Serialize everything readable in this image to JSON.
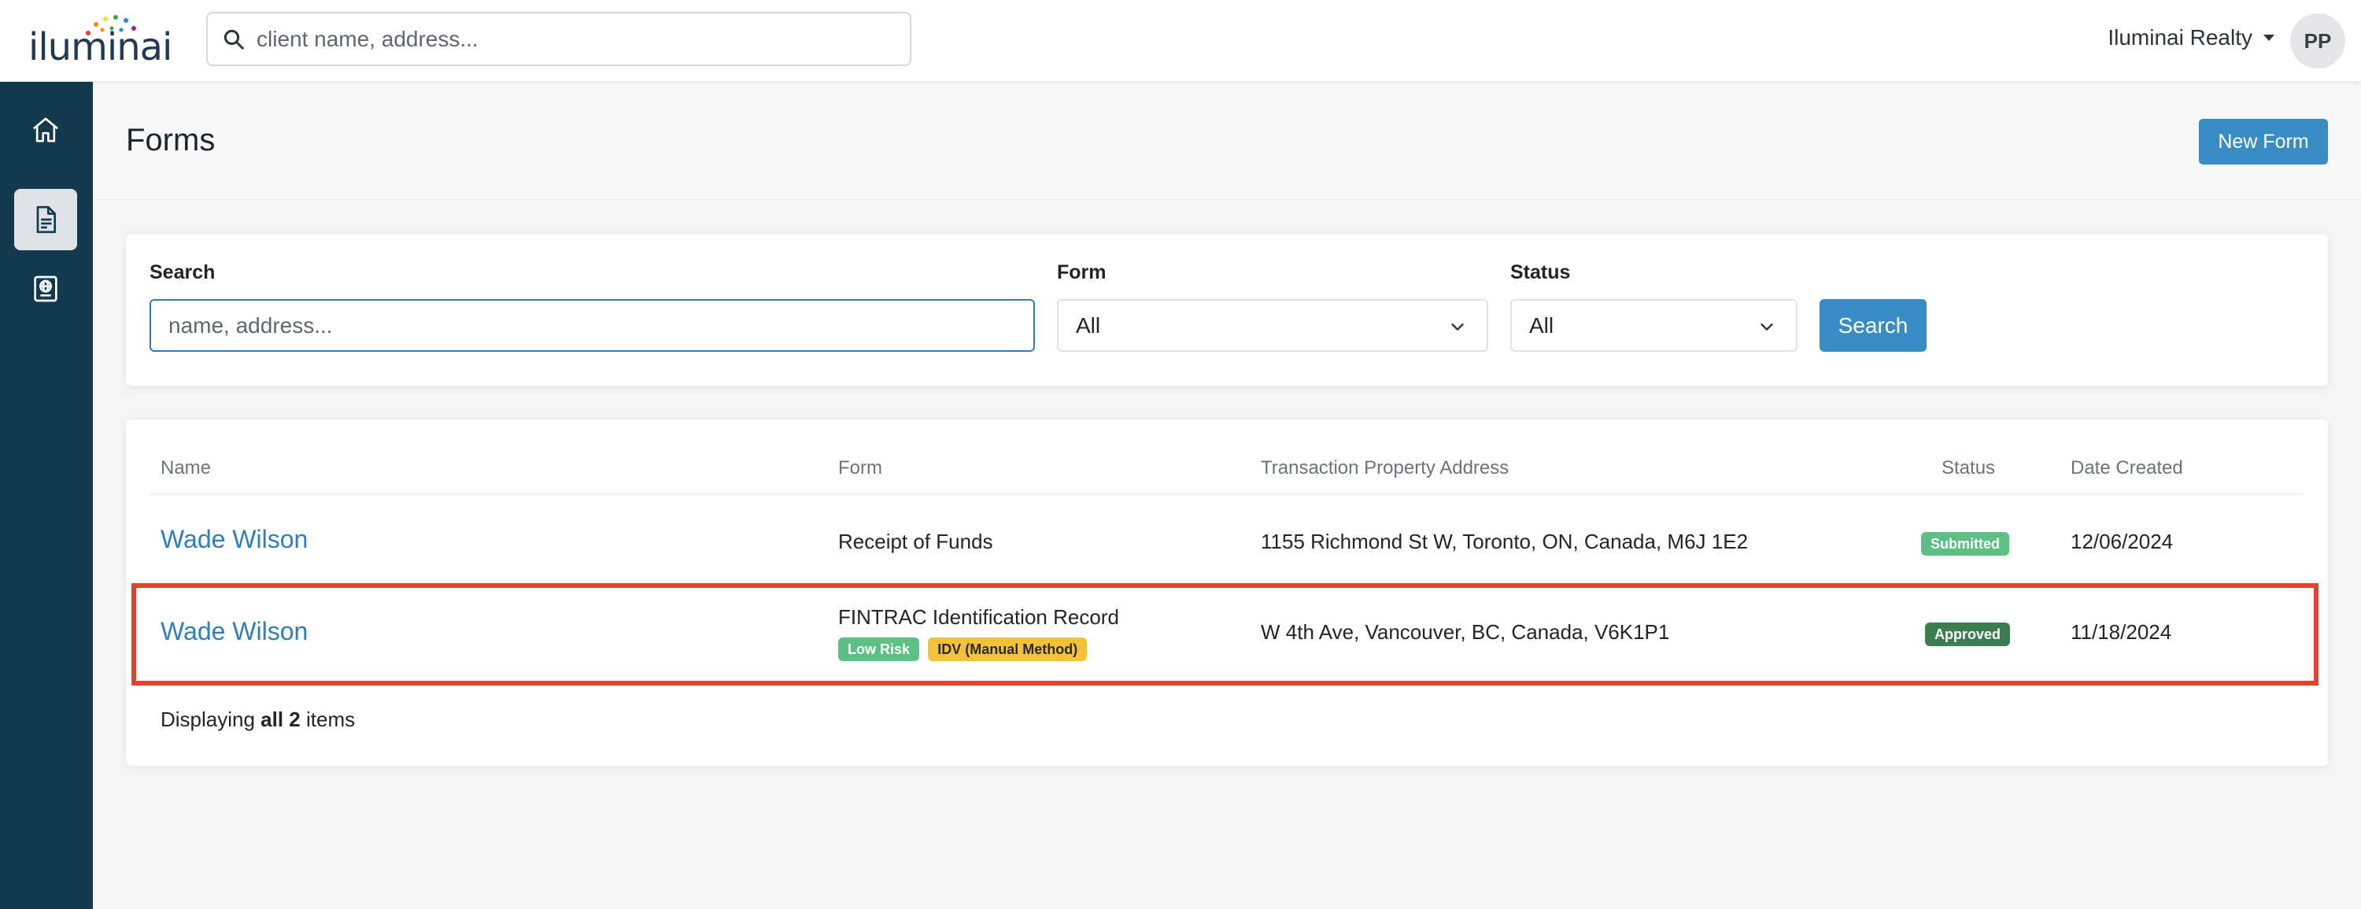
{
  "brand": {
    "logo_text": "iluminai",
    "logo_dot_colors": [
      "#e53935",
      "#fb8c00",
      "#fdd835",
      "#43a047",
      "#1e88e5",
      "#8e24aa"
    ]
  },
  "topbar": {
    "search_placeholder": "client name, address...",
    "account_name": "Iluminai Realty",
    "avatar_initials": "PP"
  },
  "sidebar": {
    "items": [
      {
        "icon": "home-icon",
        "active": false
      },
      {
        "icon": "document-icon",
        "active": true
      },
      {
        "icon": "globe-id-icon",
        "active": false
      }
    ]
  },
  "page": {
    "title": "Forms",
    "new_form_label": "New Form"
  },
  "filters": {
    "search_label": "Search",
    "search_placeholder": "name, address...",
    "form_label": "Form",
    "form_value": "All",
    "status_label": "Status",
    "status_value": "All",
    "search_button": "Search"
  },
  "table": {
    "columns": [
      "Name",
      "Form",
      "Transaction Property Address",
      "Status",
      "Date Created"
    ],
    "rows": [
      {
        "name": "Wade Wilson",
        "form": "Receipt of Funds",
        "tags": [],
        "address": "1155 Richmond St W, Toronto, ON, Canada, M6J 1E2",
        "status": "Submitted",
        "date": "12/06/2024"
      },
      {
        "name": "Wade Wilson",
        "form": "FINTRAC Identification Record",
        "tags": [
          "Low Risk",
          "IDV (Manual Method)"
        ],
        "address": "W 4th Ave, Vancouver, BC, Canada, V6K1P1",
        "status": "Approved",
        "date": "11/18/2024"
      }
    ],
    "footer": {
      "prefix": "Displaying ",
      "bold": "all 2",
      "suffix": " items"
    }
  },
  "colors": {
    "accent": "#3a8cc4",
    "sidebar": "#12394e",
    "submitted": "#5cbf84",
    "approved": "#3b7d4f",
    "idv": "#f3c13a",
    "highlight": "#e5402b"
  }
}
